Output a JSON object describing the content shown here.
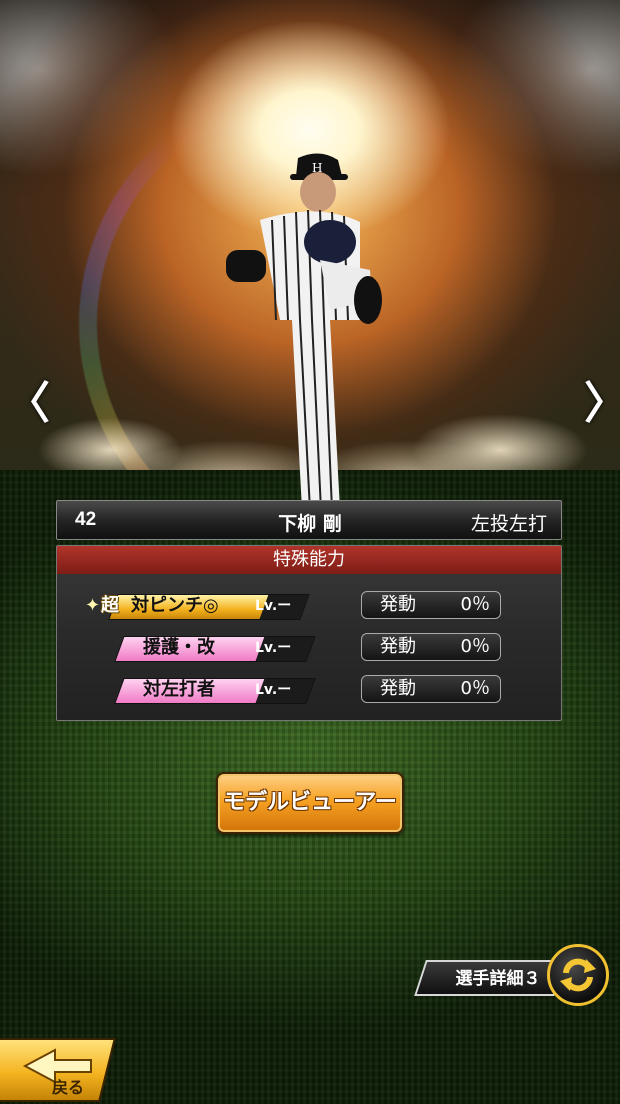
{
  "player": {
    "number": "42",
    "name": "下柳 剛",
    "handedness": "左投左打"
  },
  "navigation": {
    "prev_icon": "chevron-left-icon",
    "next_icon": "chevron-right-icon",
    "prev_label": "〈",
    "next_label": "〉"
  },
  "skills": {
    "header": "特殊能力",
    "items": [
      {
        "prefix": "超",
        "name": "対ピンチ◎",
        "level": "Lv.ー",
        "status": "発動",
        "rate": "0％",
        "style": "gold"
      },
      {
        "prefix": "",
        "name": "援護・改",
        "level": "Lv.ー",
        "status": "発動",
        "rate": "0％",
        "style": "pink"
      },
      {
        "prefix": "",
        "name": "対左打者",
        "level": "Lv.ー",
        "status": "発動",
        "rate": "0％",
        "style": "pink"
      }
    ]
  },
  "buttons": {
    "model_viewer": "モデルビューアー",
    "player_detail": "選手詳細３",
    "back": "戻る"
  },
  "colors": {
    "accent_orange": "#f6a223",
    "skill_header_red": "#9a2a22",
    "gold_tag": "#f3b21d",
    "pink_tag": "#f07bc6"
  }
}
